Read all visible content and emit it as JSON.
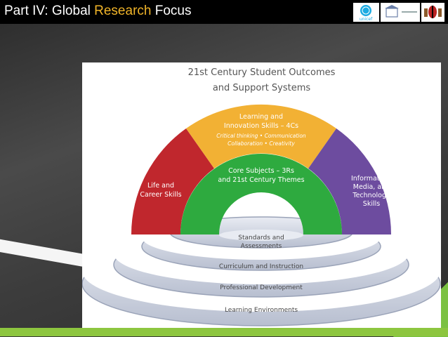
{
  "slide": {
    "title_prefix": "Part IV: Global ",
    "title_accent": "Research",
    "title_suffix": " Focus",
    "accent_color": "#f0b429"
  },
  "logos": [
    {
      "name": "unicef-logo",
      "label": "unicef"
    },
    {
      "name": "unesco-logo",
      "label": ""
    },
    {
      "name": "kenya-coat-of-arms-logo",
      "label": ""
    }
  ],
  "diagram": {
    "title_line1": "21st Century Student Outcomes",
    "title_line2": "and Support Systems",
    "arcs": {
      "life_career": {
        "line1": "Life and",
        "line2": "Career Skills",
        "color": "#c0272d"
      },
      "learning_innovation": {
        "line1": "Learning and",
        "line2": "Innovation Skills – 4Cs",
        "sub1": "Critical thinking • Communication",
        "sub2": "Collaboration • Creativity",
        "color": "#f2b134"
      },
      "info_media_tech": {
        "line1": "Information,",
        "line2": "Media, and",
        "line3": "Technology",
        "line4": "Skills",
        "color": "#6d4c9f"
      },
      "core_subjects": {
        "line1": "Core Subjects – 3Rs",
        "line2": "and 21st Century Themes",
        "color": "#2eaa3f"
      }
    },
    "rings": [
      {
        "label": "Standards and",
        "label2": "Assessments"
      },
      {
        "label": "Curriculum and Instruction"
      },
      {
        "label": "Professional Development"
      },
      {
        "label": "Learning Environments"
      }
    ]
  }
}
